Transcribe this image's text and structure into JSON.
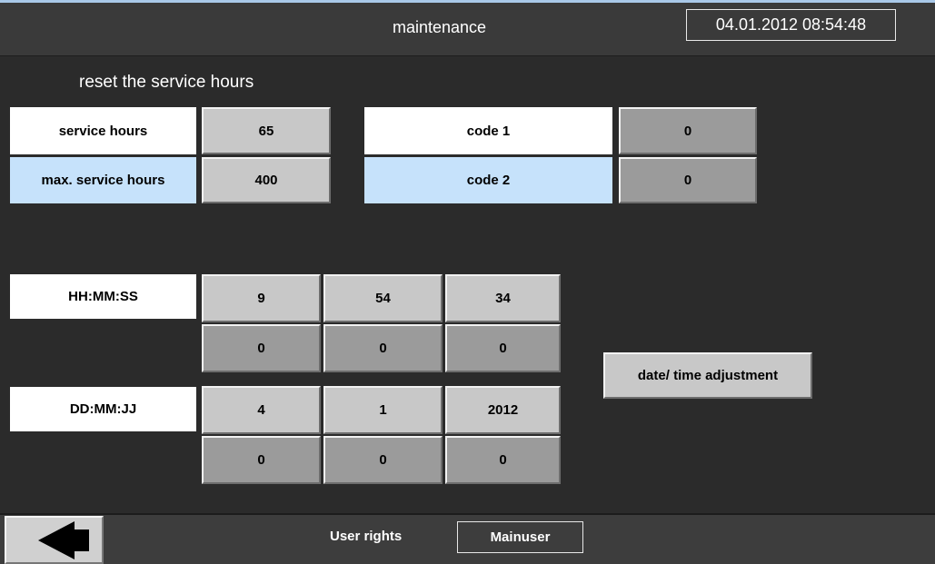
{
  "header": {
    "title": "maintenance",
    "datetime": "04.01.2012 08:54:48"
  },
  "section": {
    "title": "reset the service hours"
  },
  "service": {
    "hours_label": "service hours",
    "hours_value": "65",
    "max_label": "max. service hours",
    "max_value": "400",
    "code1_label": "code 1",
    "code1_value": "0",
    "code2_label": "code 2",
    "code2_value": "0"
  },
  "time": {
    "label": "HH:MM:SS",
    "current": [
      "9",
      "54",
      "34"
    ],
    "set": [
      "0",
      "0",
      "0"
    ]
  },
  "date": {
    "label": "DD:MM:JJ",
    "current": [
      "4",
      "1",
      "2012"
    ],
    "set": [
      "0",
      "0",
      "0"
    ]
  },
  "adjust_button": "date/ time adjustment",
  "footer": {
    "user_rights_label": "User rights",
    "user_value": "Mainuser",
    "back_icon": "arrow-left-icon"
  },
  "colors": {
    "background": "#2b2b2b",
    "label_white": "#ffffff",
    "label_blue": "#c6e2fb",
    "button_light": "#c8c8c8",
    "button_dark": "#9b9b9b"
  }
}
